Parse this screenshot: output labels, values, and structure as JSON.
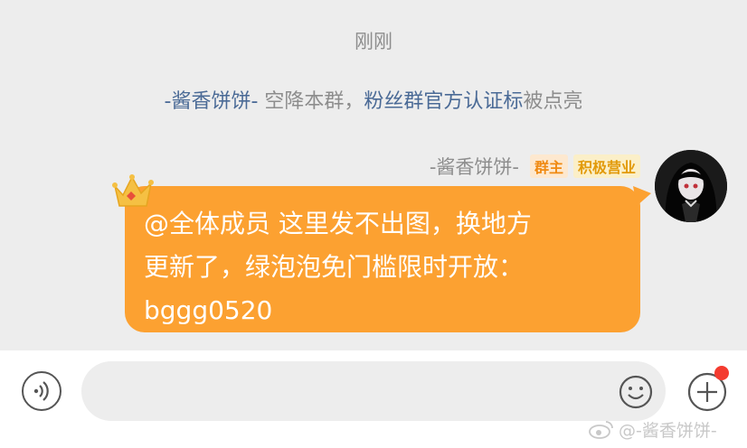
{
  "chat": {
    "timestamp": "刚刚",
    "system_message": {
      "user": "-酱香饼饼-",
      "action": " 空降本群，",
      "badge_link": "粉丝群官方认证标",
      "tail": "被点亮"
    },
    "message": {
      "sender": "-酱香饼饼-",
      "badges": [
        "群主",
        "积极营业"
      ],
      "text_line1": "@全体成员 这里发不出图，换地方",
      "text_line2": "更新了，绿泡泡免门槛限时开放：",
      "text_line3": "bggg0520"
    }
  },
  "input_bar": {
    "placeholder": "",
    "voice_icon": "voice-icon",
    "emoji_icon": "smiley-icon",
    "plus_icon": "plus-icon"
  },
  "watermark": {
    "text": "@-酱香饼饼-",
    "icon": "weibo-icon"
  },
  "colors": {
    "bubble": "#fca131",
    "link": "#4a6a96",
    "owner_badge_text": "#f08a12",
    "notification_dot": "#f43b2f"
  }
}
